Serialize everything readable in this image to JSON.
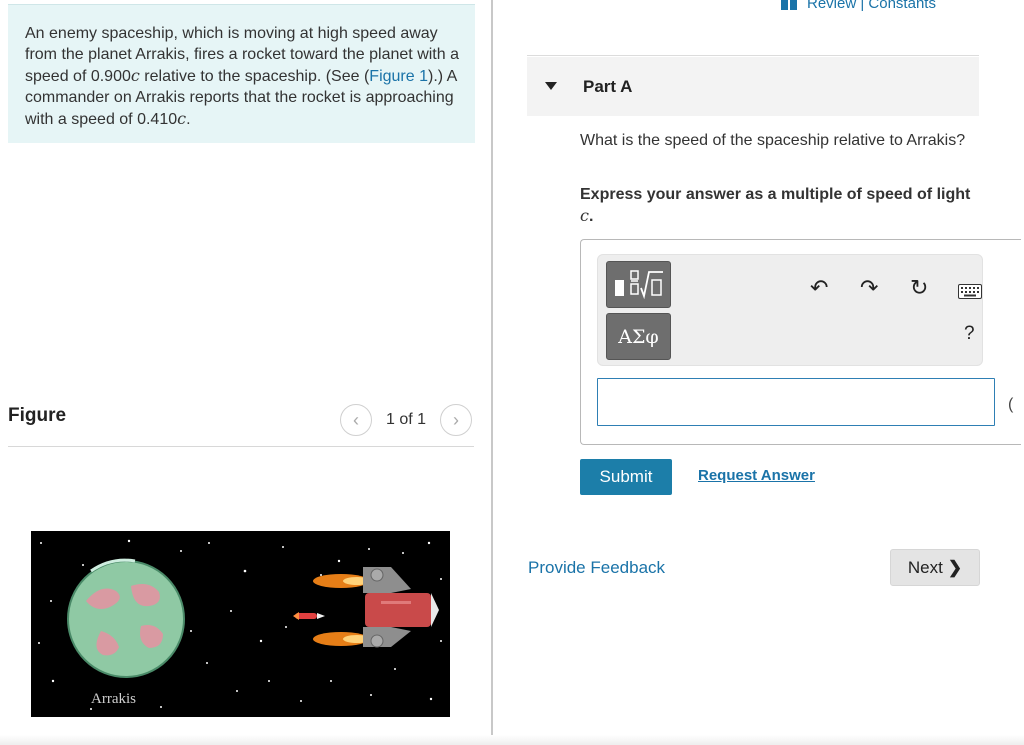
{
  "problem": {
    "text_before_link": "An enemy spaceship, which is moving at high speed away from the planet Arrakis, fires a rocket toward the planet with a speed of 0.900",
    "c1": "c",
    "text_mid": " relative to the spaceship. (See (",
    "figure_link": "Figure 1",
    "text_after_link": ").) A commander on Arrakis reports that the rocket is approaching with a speed of 0.410",
    "c2": "c",
    "end": "."
  },
  "figure": {
    "title": "Figure",
    "counter": "1 of 1",
    "prev_icon": "chevron-left-icon",
    "next_icon": "chevron-right-icon",
    "planet_label": "Arrakis"
  },
  "header": {
    "review_label": "Review | Constants"
  },
  "part": {
    "title": "Part A",
    "question": "What is the speed of the spaceship relative to Arrakis?",
    "instruction_prefix": "Express your answer as a multiple of speed of light ",
    "instruction_var": "c",
    "instruction_suffix": "."
  },
  "toolbar": {
    "math_template_icon": "math-template-icon",
    "greek_label": "ΑΣφ",
    "undo_icon": "undo-icon",
    "redo_icon": "redo-icon",
    "reset_icon": "reset-icon",
    "keyboard_icon": "keyboard-icon",
    "help_label": "?"
  },
  "answer": {
    "value": "",
    "placeholder": ""
  },
  "actions": {
    "submit_label": "Submit",
    "request_label": "Request Answer",
    "feedback_label": "Provide Feedback",
    "next_label": "Next",
    "side_glyph": "("
  },
  "colors": {
    "accent": "#1c7ea9",
    "link": "#1a73a8",
    "problem_bg": "#e6f5f6"
  }
}
